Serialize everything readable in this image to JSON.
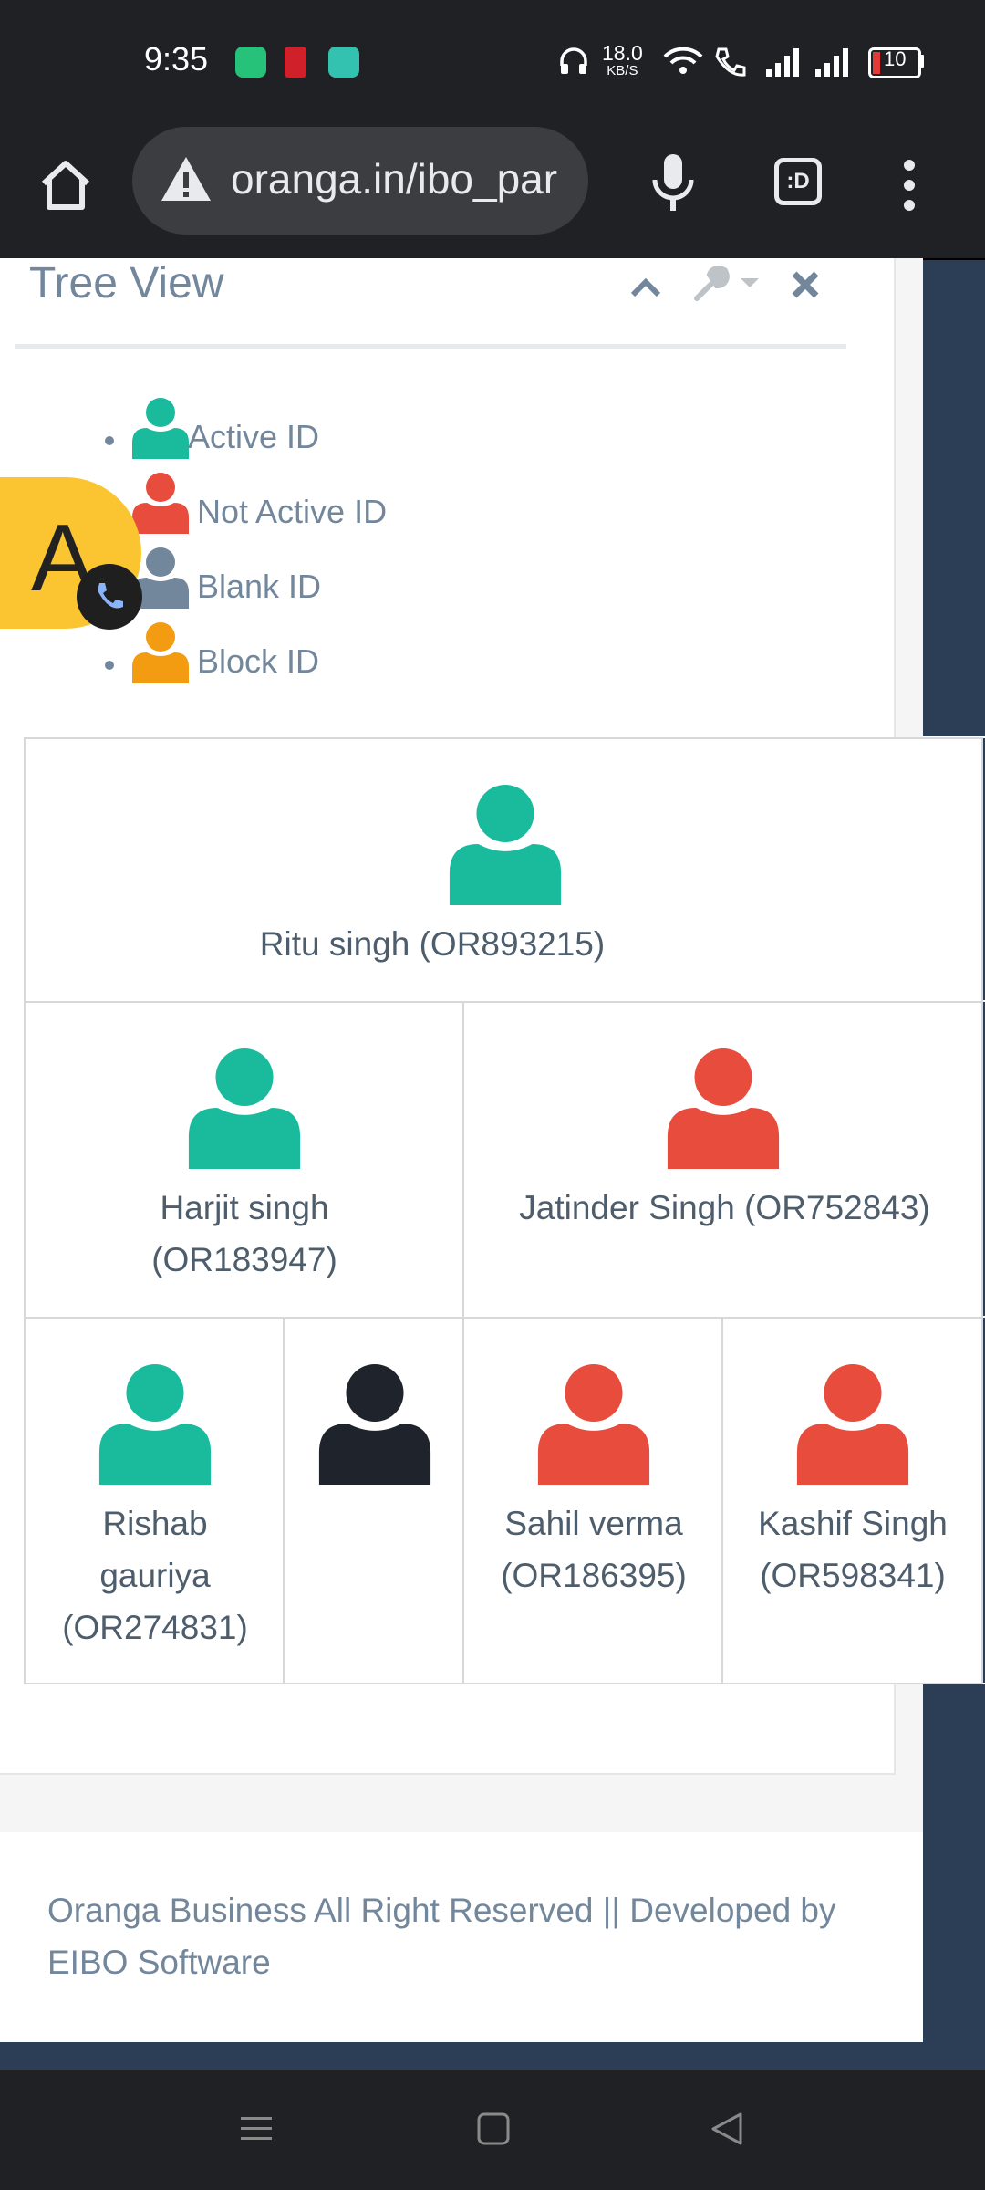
{
  "status_bar": {
    "time": "9:35",
    "net_speed_value": "18.0",
    "net_speed_unit": "KB/S",
    "battery": "10",
    "icons": [
      "battery-saver-icon",
      "app-red-icon",
      "app-teal-icon",
      "headphones-icon",
      "wifi-icon",
      "volte-call-icon",
      "signal-1-icon",
      "signal-2-icon",
      "battery-icon"
    ]
  },
  "browser": {
    "url": "oranga.in/ibo_par",
    "tab_count": ":D",
    "icons": [
      "home-icon",
      "warning-icon",
      "mic-icon",
      "tabs-icon",
      "more-vert-icon"
    ]
  },
  "panel": {
    "title": "Tree View",
    "tools": [
      "collapse-chevron-icon",
      "wrench-icon",
      "close-icon"
    ]
  },
  "legend": [
    {
      "label": "Active ID",
      "color": "#1abb9c"
    },
    {
      "label": "Not Active ID",
      "color": "#e74c3c"
    },
    {
      "label": "Blank ID",
      "color": "#73879c"
    },
    {
      "label": "Block ID",
      "color": "#f39c12"
    }
  ],
  "tree": {
    "root": {
      "name": "Ritu singh (OR893215)",
      "status": "active"
    },
    "level1": [
      {
        "name": "Harjit singh (OR183947)",
        "status": "active"
      },
      {
        "name": "Jatinder Singh (OR752843)",
        "status": "not-active"
      }
    ],
    "level2": [
      {
        "name": "Rishab gauriya (OR274831)",
        "status": "active"
      },
      {
        "name": "",
        "status": "blank"
      },
      {
        "name": "Sahil verma (OR186395)",
        "status": "not-active"
      },
      {
        "name": "Kashif Singh (OR598341)",
        "status": "not-active"
      }
    ]
  },
  "colors": {
    "active": "#1abb9c",
    "not_active": "#e74c3c",
    "blank": "#1f232b",
    "block": "#f39c12",
    "legend_blank": "#73879c"
  },
  "floating_avatar": {
    "letter": "A",
    "icon": "phone-icon"
  },
  "footer": {
    "text": "Oranga Business All Right Reserved || Developed by EIBO Software"
  },
  "nav": {
    "icons": [
      "menu-icon",
      "home-square-icon",
      "back-icon"
    ]
  }
}
